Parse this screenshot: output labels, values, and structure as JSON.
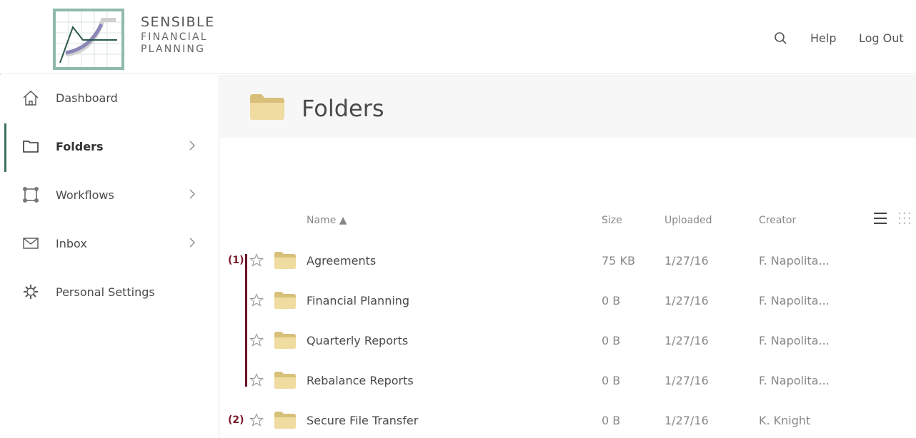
{
  "brand": {
    "line1": "SENSIBLE",
    "line2": "FINANCIAL",
    "line3": "PLANNING"
  },
  "header": {
    "help_label": "Help",
    "logout_label": "Log Out"
  },
  "sidebar": {
    "items": [
      {
        "label": "Dashboard",
        "icon": "home-icon"
      },
      {
        "label": "Folders",
        "icon": "folder-outline-icon"
      },
      {
        "label": "Workflows",
        "icon": "workflow-icon"
      },
      {
        "label": "Inbox",
        "icon": "envelope-icon"
      },
      {
        "label": "Personal Settings",
        "icon": "gear-icon"
      }
    ]
  },
  "main": {
    "title": "Folders",
    "columns": {
      "name": "Name ▲",
      "size": "Size",
      "uploaded": "Uploaded",
      "creator": "Creator"
    },
    "rows": [
      {
        "tag": "(1)",
        "name": "Agreements",
        "size": "75 KB",
        "uploaded": "1/27/16",
        "creator": "F. Napolita..."
      },
      {
        "tag": "",
        "name": "Financial Planning",
        "size": "0 B",
        "uploaded": "1/27/16",
        "creator": "F. Napolita..."
      },
      {
        "tag": "",
        "name": "Quarterly Reports",
        "size": "0 B",
        "uploaded": "1/27/16",
        "creator": "F. Napolita..."
      },
      {
        "tag": "",
        "name": "Rebalance Reports",
        "size": "0 B",
        "uploaded": "1/27/16",
        "creator": "F. Napolita..."
      },
      {
        "tag": "(2)",
        "name": "Secure File Transfer",
        "size": "0 B",
        "uploaded": "1/27/16",
        "creator": "K. Knight"
      }
    ]
  },
  "colors": {
    "accent": "#3f6f63",
    "logo_border": "#8fb9ae",
    "annotation": "#6b1424",
    "folder_fill": "#f0dca0"
  }
}
